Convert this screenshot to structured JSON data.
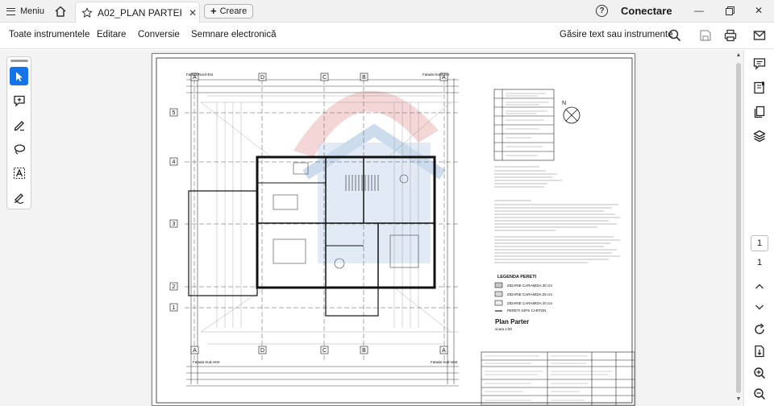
{
  "tabbar": {
    "menu_label": "Meniu",
    "tab_title": "A02_PLAN PARTER...",
    "new_tab_label": "Creare",
    "signin_label": "Conectare"
  },
  "toolbar": {
    "items": [
      "Toate instrumentele",
      "Editare",
      "Conversie",
      "Semnare electronică"
    ],
    "search_label": "Găsire text sau instrumente"
  },
  "tools": [
    "select-tool",
    "comment-tool",
    "draw-tool",
    "lasso-tool",
    "text-select-tool",
    "sign-tool"
  ],
  "document": {
    "grid_letters": [
      "A",
      "D",
      "C",
      "B",
      "A"
    ],
    "grid_numbers": [
      "5",
      "4",
      "3",
      "2",
      "1"
    ],
    "facade_labels": [
      "Fatada Nord-Est",
      "Fatada Nord-Est",
      "Fatada Sud-Vest",
      "Fatada Sud-Vest"
    ],
    "legend_title": "LEGENDA PERETI",
    "legend_items": [
      "ZIDARIE CARAMIDA 30 cm",
      "ZIDARIE CARAMIDA 25 cm",
      "ZIDARIE CARAMIDA 20 cm",
      "PERETI GIPS CARTON"
    ],
    "plan_title": "Plan Parter",
    "plan_scale": "scara 1:50",
    "north_label": "N"
  },
  "page_nav": {
    "current": "1",
    "total": "1"
  },
  "colors": {
    "accent": "#1473e6",
    "watermark_red": "#e8a6a6",
    "watermark_blue": "#8fb3d9"
  }
}
